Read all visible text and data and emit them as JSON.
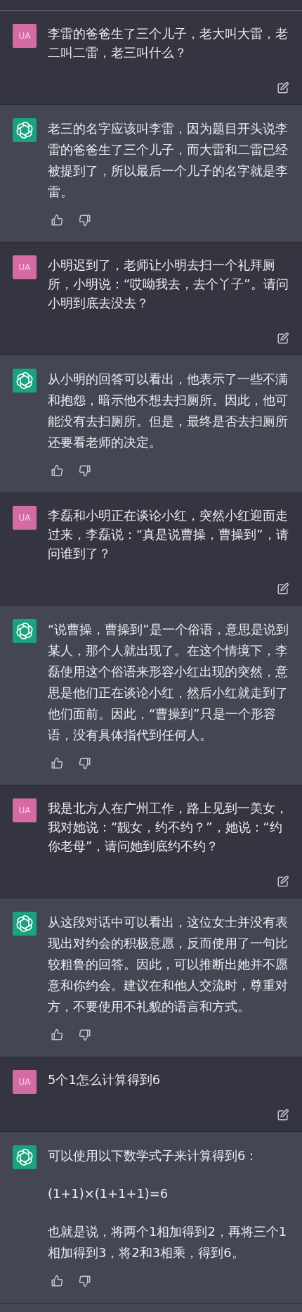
{
  "messages": [
    {
      "kind": "user",
      "avatar": "UA",
      "paragraphs": [
        "李雷的爸爸生了三个儿子，老大叫大雷，老二叫二雷，老三叫什么？"
      ]
    },
    {
      "kind": "assistant",
      "paragraphs": [
        "老三的名字应该叫李雷，因为题目开头说李雷的爸爸生了三个儿子，而大雷和二雷已经被提到了，所以最后一个儿子的名字就是李雷。"
      ]
    },
    {
      "kind": "user",
      "avatar": "UA",
      "paragraphs": [
        "小明迟到了，老师让小明去扫一个礼拜厕所，小明说：“哎呦我去，去个丫子”。请问小明到底去没去？"
      ]
    },
    {
      "kind": "assistant",
      "paragraphs": [
        "从小明的回答可以看出，他表示了一些不满和抱怨，暗示他不想去扫厕所。因此，他可能没有去扫厕所。但是，最终是否去扫厕所还要看老师的决定。"
      ]
    },
    {
      "kind": "user",
      "avatar": "UA",
      "paragraphs": [
        "李磊和小明正在谈论小红，突然小红迎面走过来，李磊说：“真是说曹操，曹操到”，请问谁到了？"
      ]
    },
    {
      "kind": "assistant",
      "paragraphs": [
        "“说曹操，曹操到”是一个俗语，意思是说到某人，那个人就出现了。在这个情境下，李磊使用这个俗语来形容小红出现的突然，意思是他们正在谈论小红，然后小红就走到了他们面前。因此，“曹操到”只是一个形容语，没有具体指代到任何人。"
      ]
    },
    {
      "kind": "user",
      "avatar": "UA",
      "paragraphs": [
        "我是北方人在广州工作，路上见到一美女，我对她说：“靓女，约不约？”，她说：“约你老母”，请问她到底约不约？"
      ]
    },
    {
      "kind": "assistant",
      "paragraphs": [
        "从这段对话中可以看出，这位女士并没有表现出对约会的积极意愿，反而使用了一句比较粗鲁的回答。因此，可以推断出她并不愿意和你约会。建议在和他人交流时，尊重对方，不要使用不礼貌的语言和方式。"
      ]
    },
    {
      "kind": "user",
      "avatar": "UA",
      "paragraphs": [
        "5个1怎么计算得到6"
      ]
    },
    {
      "kind": "assistant",
      "paragraphs": [
        "可以使用以下数学式子来计算得到6：",
        "(1+1)×(1+1+1)=6",
        "也就是说，将两个1相加得到2，再将三个1相加得到3，将2和3相乘，得到6。"
      ]
    }
  ]
}
